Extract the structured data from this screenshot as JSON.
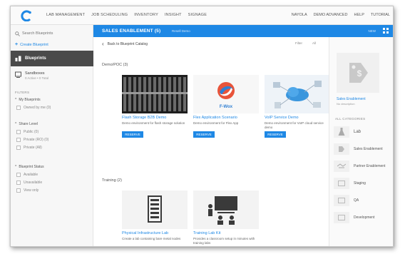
{
  "topnav": {
    "items": [
      "LAB MANAGEMENT",
      "JOB SCHEDULING",
      "INVENTORY",
      "INSIGHT",
      "SIGNAGE"
    ],
    "right_items": [
      "NAYOLA",
      "DEMO ADVANCED",
      "HELP",
      "TUTORIAL"
    ]
  },
  "sidebar": {
    "search_placeholder": "Search Blueprints",
    "create_label": "Create Blueprint",
    "active_item": "Blueprints",
    "sandbox_label": "Sandboxes",
    "sandbox_sub": "0 Active • 0 Total",
    "filters_header": "FILTERS",
    "group1": {
      "label": "My Blueprints",
      "options": [
        "Owned by me (0)"
      ]
    },
    "group2": {
      "label": "Share Level",
      "options": [
        "Public (0)",
        "Private (RO) (0)",
        "Private (All)"
      ]
    },
    "group3": {
      "label": "Blueprint Status",
      "options": [
        "Available",
        "Unavailable",
        "View only"
      ]
    }
  },
  "header": {
    "title": "SALES ENABLEMENT (5)",
    "subtitle": "Resell Demo",
    "right_text": "NEW"
  },
  "content": {
    "back_label": "Back to Blueprint Catalog",
    "sort_label": "Filter",
    "sort_value": "All",
    "section1": "Demo/POC (3)",
    "section2": "Training (2)",
    "cards": [
      {
        "title": "Flash Storage B2B Demo",
        "desc": "Demo environment for flash storage solution",
        "button": "RESERVE"
      },
      {
        "title": "Flex Application Scenario",
        "desc": "Demo environment for Flex App",
        "button": "RESERVE"
      },
      {
        "title": "VoIP Service Demo",
        "desc": "Demo environment for VoIP cloud service demo",
        "button": "RESERVE"
      },
      {
        "title": "Physical Infrastructure Lab",
        "desc": "Create a lab containing bare metal nodes",
        "button": ""
      },
      {
        "title": "Training Lab Kit",
        "desc": "Provides a classroom setup in minutes with training labs",
        "button": ""
      }
    ],
    "logo_text": "F-Wox"
  },
  "rpanel": {
    "title": "Sales Enablement",
    "subtitle": "No description",
    "categories_header": "ALL CATEGORIES",
    "categories": [
      "Lab",
      "Sales Enablement",
      "Partner Enablement",
      "Staging",
      "QA",
      "Development"
    ]
  },
  "colors": {
    "accent": "#1e88e5",
    "sidebar_active": "#4a4a4a"
  }
}
